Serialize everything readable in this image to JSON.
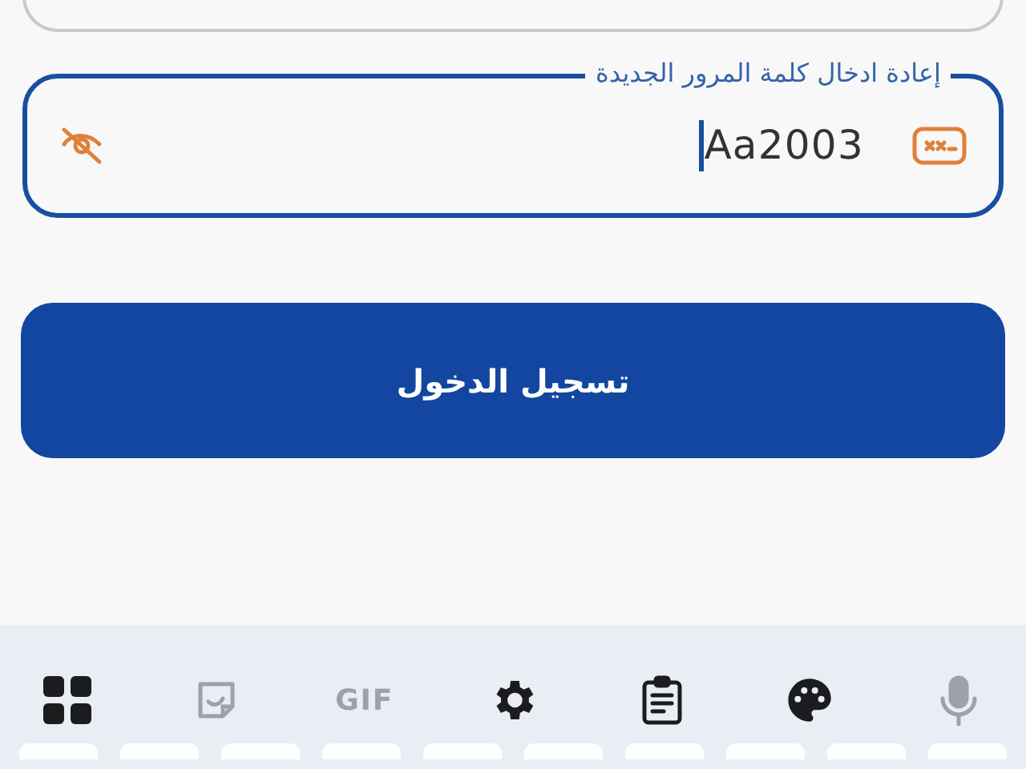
{
  "confirm_password_field": {
    "label": "إعادة ادخال كلمة المرور الجديدة",
    "value": "Aa2003",
    "focused": true
  },
  "login_button": {
    "label": "تسجيل الدخول"
  },
  "keyboard_toolbar": [
    {
      "kind": "apps",
      "disabled": false
    },
    {
      "kind": "sticker",
      "disabled": true
    },
    {
      "kind": "gif",
      "label": "GIF",
      "disabled": true
    },
    {
      "kind": "settings",
      "disabled": false
    },
    {
      "kind": "clipboard",
      "disabled": false
    },
    {
      "kind": "palette",
      "disabled": false
    },
    {
      "kind": "mic",
      "disabled": true
    }
  ]
}
